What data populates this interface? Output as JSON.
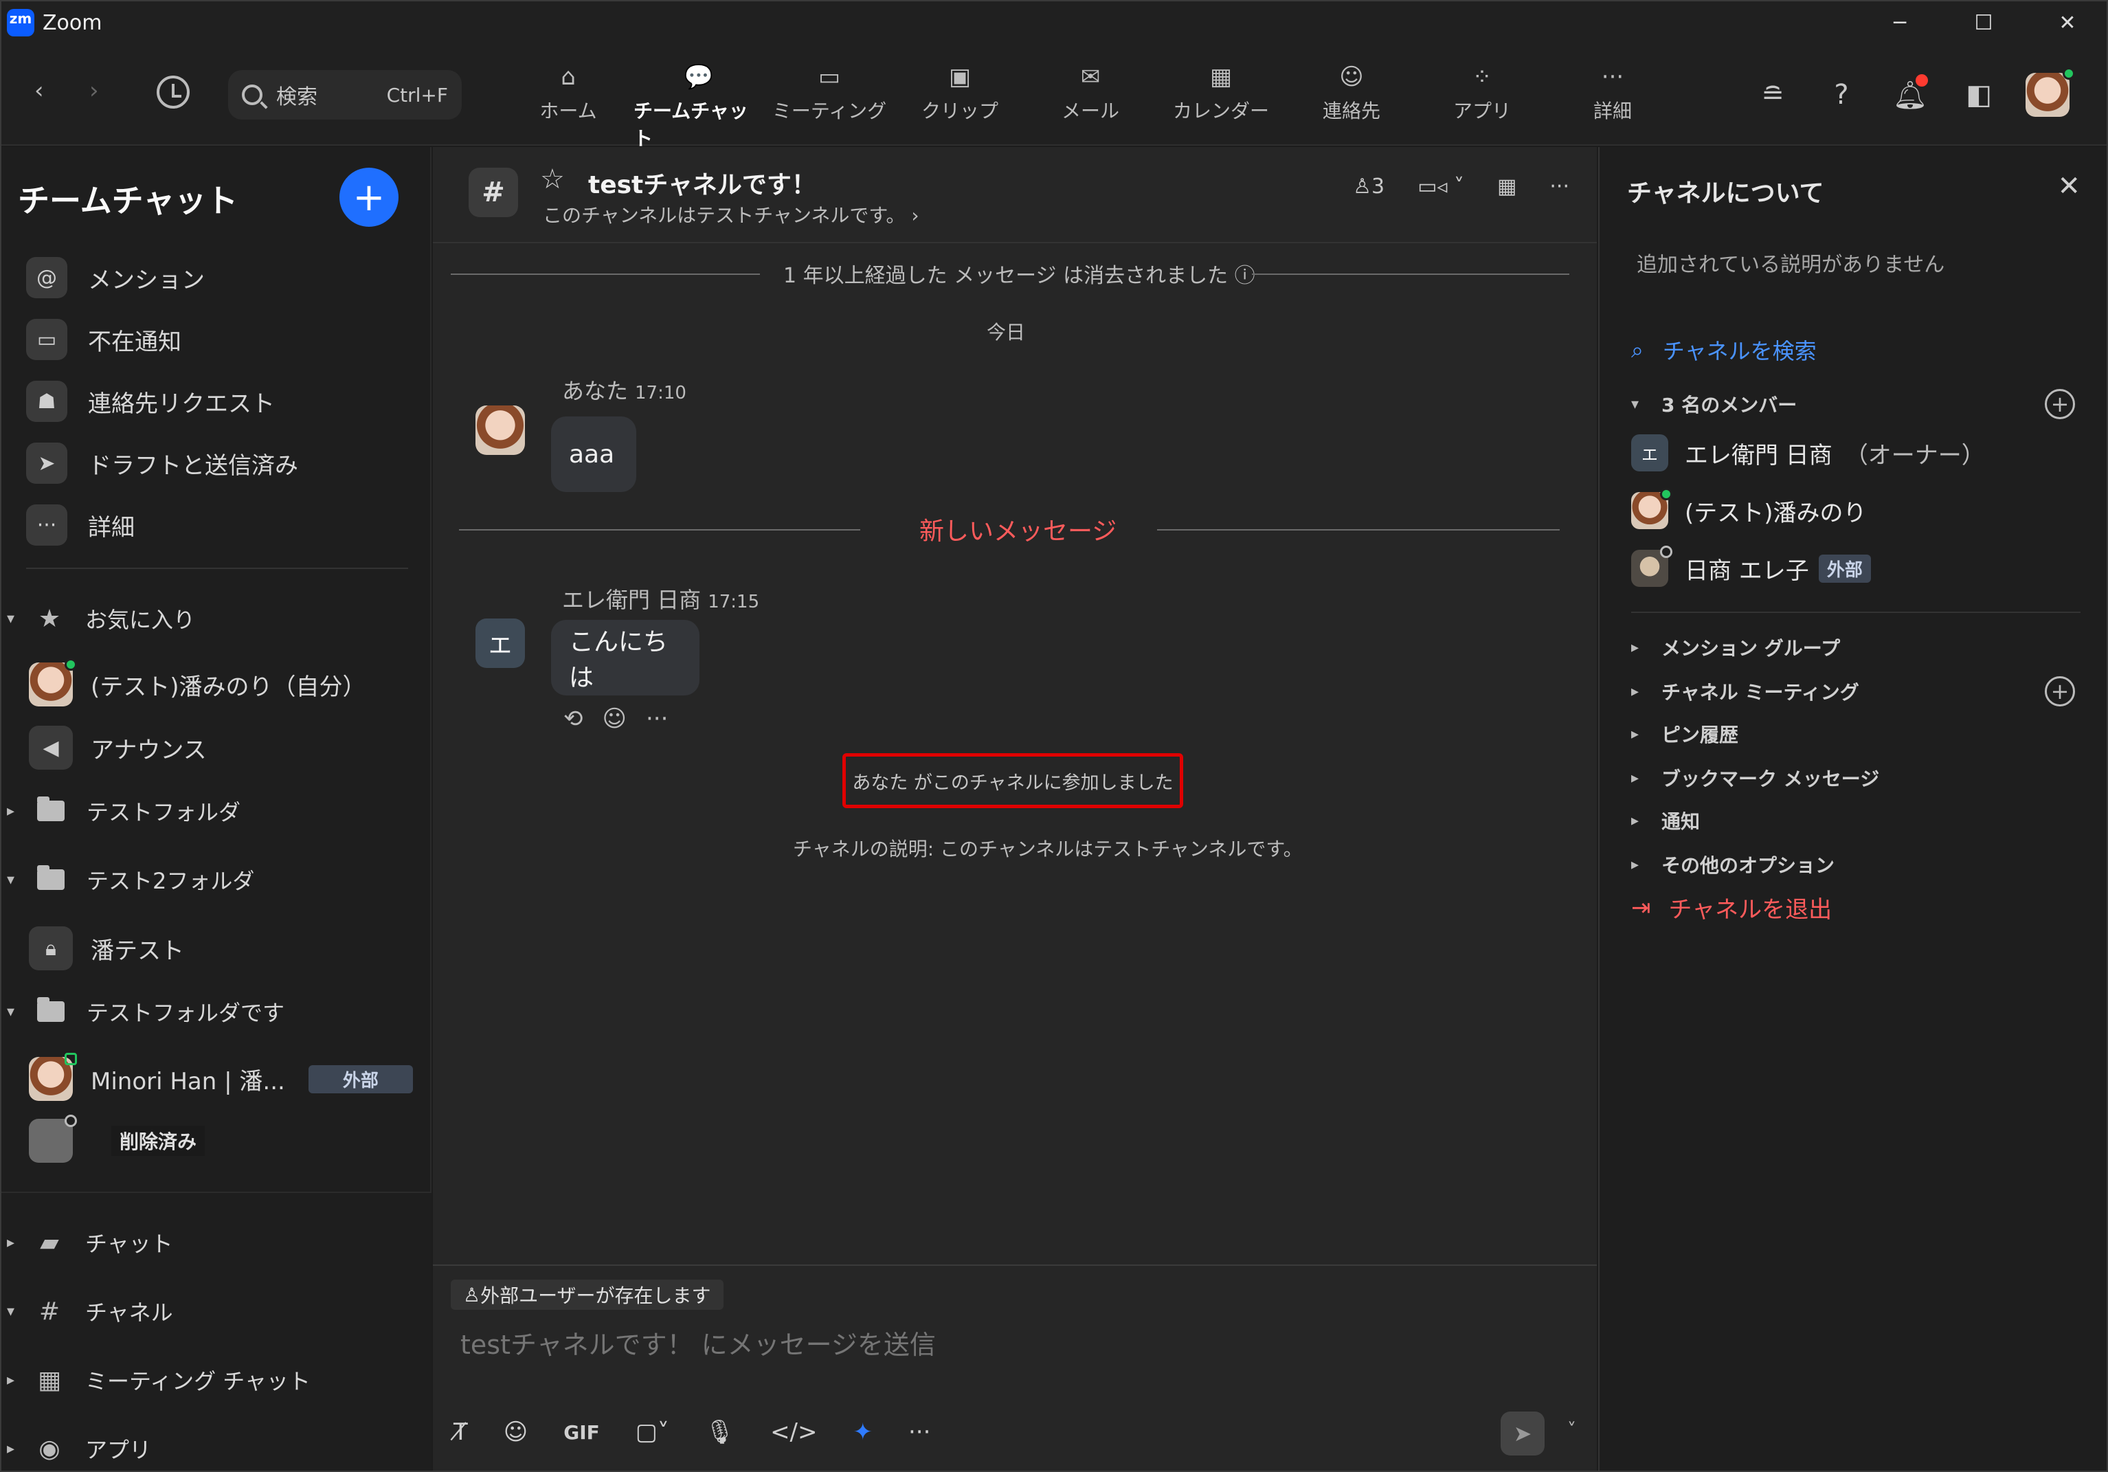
{
  "window": {
    "app_title": "Zoom",
    "logo_text": "zm",
    "controls": [
      "─",
      "☐",
      "✕"
    ]
  },
  "toolbar": {
    "search_label": "検索",
    "search_shortcut": "Ctrl+F",
    "tabs": [
      {
        "label": "ホーム",
        "icon": "home-icon"
      },
      {
        "label": "チームチャット",
        "icon": "chat-icon"
      },
      {
        "label": "ミーティング",
        "icon": "video-icon"
      },
      {
        "label": "クリップ",
        "icon": "clips-icon"
      },
      {
        "label": "メール",
        "icon": "mail-icon"
      },
      {
        "label": "カレンダー",
        "icon": "calendar-icon"
      },
      {
        "label": "連絡先",
        "icon": "contacts-icon"
      },
      {
        "label": "アプリ",
        "icon": "apps-icon"
      },
      {
        "label": "詳細",
        "icon": "more-icon"
      }
    ],
    "active_tab": "チームチャット"
  },
  "sidebar": {
    "title": "チームチャット",
    "items": [
      {
        "label": "メンション",
        "icon": "mention-icon"
      },
      {
        "label": "不在通知",
        "icon": "missed-call-icon"
      },
      {
        "label": "連絡先リクエスト",
        "icon": "contact-request-icon"
      },
      {
        "label": "ドラフトと送信済み",
        "icon": "draft-icon"
      },
      {
        "label": "詳細",
        "icon": "more-icon"
      }
    ],
    "favorites": {
      "label": "お気に入り",
      "items": [
        {
          "label": "(テスト)潘みのり（自分）"
        },
        {
          "label": "アナウンス"
        }
      ]
    },
    "folders": [
      {
        "label": "テストフォルダ"
      },
      {
        "label": "テスト2フォルダ",
        "children": [
          {
            "label": "潘テスト"
          }
        ]
      },
      {
        "label": "テストフォルダです",
        "children": [
          {
            "label": "Minori Han | 潘...",
            "badge": "外部"
          },
          {
            "label": "",
            "badge": "削除済み"
          }
        ]
      }
    ],
    "bottom_sections": [
      {
        "label": "チャット",
        "icon": "chat-bubble-icon"
      },
      {
        "label": "チャネル",
        "icon": "hash-icon"
      },
      {
        "label": "ミーティング チャット",
        "icon": "calendar-icon"
      },
      {
        "label": "アプリ",
        "icon": "apps-icon"
      }
    ]
  },
  "channel": {
    "hash": "#",
    "name": "testチャネルです！",
    "description": "このチャンネルはテストチャンネルです。",
    "member_count": "3",
    "deleted_notice": "1 年以上経過した メッセージ は消去されました",
    "today_label": "今日",
    "messages": [
      {
        "sender": "あなた",
        "time": "17:10",
        "text": "aaa"
      },
      {
        "sender": "エレ衛門 日商",
        "time": "17:15",
        "text": "こんにちは",
        "avatar_letter": "エ"
      }
    ],
    "new_messages_label": "新しいメッセージ",
    "joined_notice": "あなた がこのチャネルに参加しました",
    "description_notice": "チャネルの説明: このチャンネルはテストチャンネルです。"
  },
  "composer": {
    "external_notice": "外部ユーザーが存在します",
    "placeholder": "testチャネルです！ にメッセージを送信",
    "gif_label": "GIF"
  },
  "right_panel": {
    "title": "チャネルについて",
    "no_description": "追加されている説明がありません",
    "search_channel": "チャネルを検索",
    "members_header": "3 名のメンバー",
    "members": [
      {
        "name": "エレ衛門 日商",
        "suffix": "（オーナー）",
        "avatar_letter": "エ"
      },
      {
        "name": "(テスト)潘みのり",
        "suffix": ""
      },
      {
        "name": "日商 エレ子",
        "badge": "外部"
      }
    ],
    "accordions": [
      "メンション グループ",
      "チャネル ミーティング",
      "ピン履歴",
      "ブックマーク メッセージ",
      "通知",
      "その他のオプション"
    ],
    "leave_channel": "チャネルを退出"
  },
  "colors": {
    "accent": "#1f6fff",
    "link": "#4a93ff",
    "danger": "#ff5b5b",
    "highlight_box": "#e00000",
    "online": "#22c55e"
  }
}
